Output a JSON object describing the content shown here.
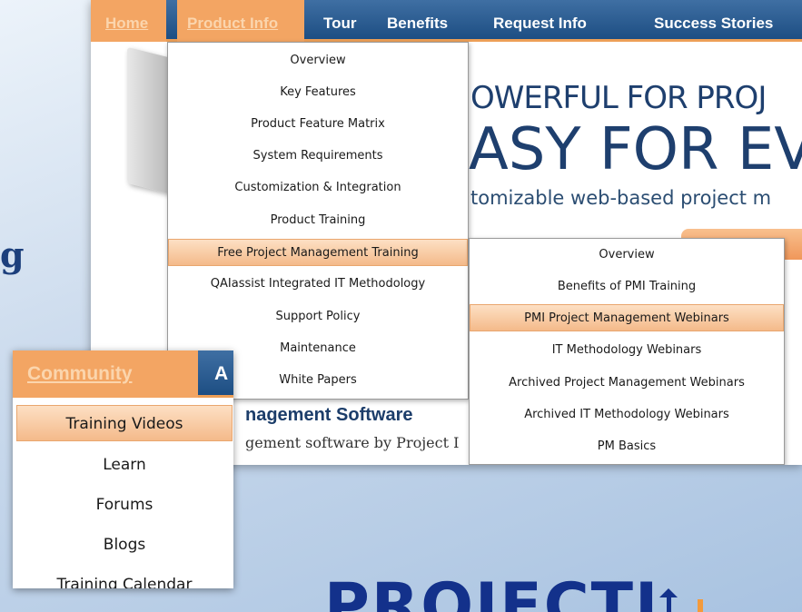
{
  "side_letter": "g",
  "top_nav": {
    "items": [
      "Home",
      "Product Info",
      "Tour",
      "Benefits",
      "Request Info",
      "Success Stories"
    ],
    "active": [
      "Home",
      "Product Info"
    ]
  },
  "hero": {
    "headline_1": "OWERFUL FOR PROJ",
    "headline_2": "ASY FOR EV",
    "subline": "tomizable web-based project m"
  },
  "body": {
    "section_title": "nagement Software",
    "section_text": "gement software by Project I"
  },
  "product_info_menu": {
    "items": [
      "Overview",
      "Key Features",
      "Product Feature Matrix",
      "System Requirements",
      "Customization & Integration",
      "Product Training",
      "Free Project Management Training",
      "QAIassist Integrated IT Methodology",
      "Support Policy",
      "Maintenance",
      "White Papers"
    ],
    "highlighted": "Free Project Management Training"
  },
  "training_submenu": {
    "items": [
      "Overview",
      "Benefits of PMI Training",
      "PMI Project Management Webinars",
      "IT Methodology Webinars",
      "Archived Project Management Webinars",
      "Archived IT Methodology Webinars",
      "PM Basics"
    ],
    "highlighted": "PMI Project Management Webinars"
  },
  "community": {
    "tab_label": "Community",
    "next_tab_label": "A",
    "items": [
      "Training Videos",
      "Learn",
      "Forums",
      "Blogs",
      "Training Calendar"
    ],
    "highlighted": "Training Videos"
  },
  "footer_logo_text": "PROJECTI",
  "colors": {
    "nav_blue": "#1d4e83",
    "accent_orange": "#f3a563",
    "highlight": "#f4ba8a",
    "logo_blue": "#13318b"
  }
}
